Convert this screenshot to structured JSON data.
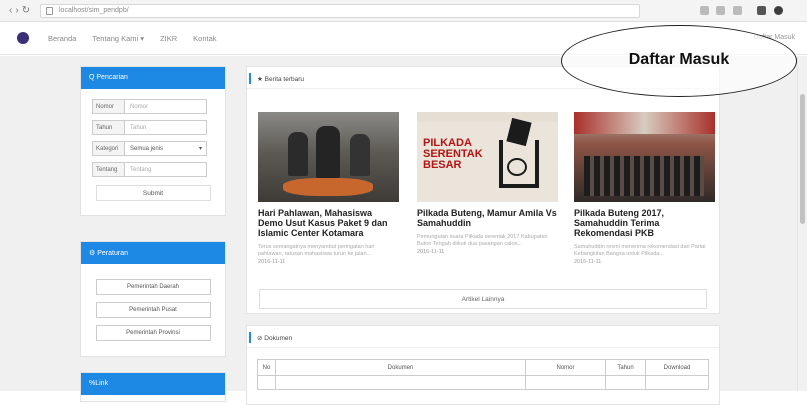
{
  "browser": {
    "url": "localhost/sim_pendpb/"
  },
  "appbar": {
    "menu": [
      "Beranda",
      "Tentang Kami ▾",
      "ZIKR",
      "Kontak"
    ],
    "login_link": "Daftar Masuk"
  },
  "callout_text": "Daftar Masuk",
  "search_panel": {
    "title": "Q Pencarian",
    "rows": [
      {
        "label": "Nomor",
        "placeholder": "Nomor"
      },
      {
        "label": "Tahun",
        "placeholder": "Tahun"
      },
      {
        "label": "Kategori",
        "value": "Semua jenis",
        "type": "select"
      },
      {
        "label": "Tentang",
        "placeholder": "Tentang"
      }
    ],
    "submit": "Submit"
  },
  "regulation_panel": {
    "title": "Peraturan",
    "links": [
      "Pemerintah Daerah",
      "Pemerintah Pusat",
      "Pemerintah Provinsi"
    ]
  },
  "link_panel": {
    "title": "Link"
  },
  "news_section": {
    "title": "Berita terbaru",
    "items": [
      {
        "title": "Hari Pahlawan, Mahasiswa Demo Usut Kasus Paket 9 dan Islamic Center Kotamara",
        "summary": "Terus semangatnya menyambut peringatan hari pahlawan, ratusan mahasiswa turun ke jalan...",
        "date": "2016-11-11"
      },
      {
        "title": "Pilkada Buteng, Mamur Amila Vs Samahuddin",
        "summary": "Pemungutan suara Pilkada serentak 2017 Kabupaten Buton Tengah diikuti dua pasangan calon...",
        "date": "2016-11-11"
      },
      {
        "title": "Pilkada Buteng 2017, Samahuddin Terima Rekomendasi PKB",
        "summary": "Samahuddin resmi menerima rekomendasi dari Partai Kebangkitan Bangsa untuk Pilkada...",
        "date": "2016-11-11"
      }
    ],
    "poster_text": [
      "PILKADA",
      "SERENTAK",
      "BESAR"
    ],
    "more": "Artikel Lainnya"
  },
  "documents": {
    "title": "Dokumen",
    "columns": [
      "No",
      "Dokumen",
      "Nomor",
      "Tahun",
      "Download"
    ]
  }
}
